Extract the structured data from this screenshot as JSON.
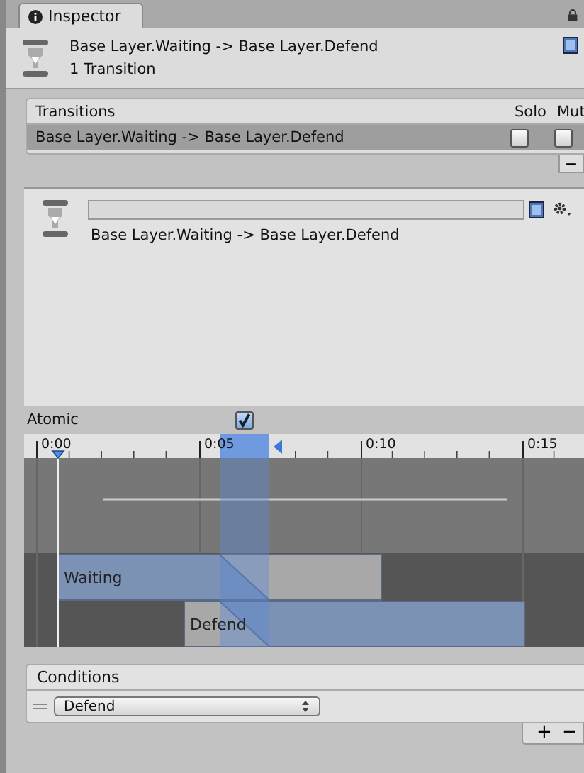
{
  "tab": {
    "title": "Inspector",
    "selected": true
  },
  "header": {
    "title": "Base Layer.Waiting -> Base Layer.Defend",
    "subtitle": "1 Transition"
  },
  "transitions": {
    "title": "Transitions",
    "columns": [
      "Solo",
      "Mut"
    ],
    "rows": [
      {
        "name": "Base Layer.Waiting -> Base Layer.Defend",
        "selected": true,
        "solo": false,
        "mute": false
      }
    ],
    "footer_buttons": [
      "−"
    ]
  },
  "transition": {
    "name": "Base Layer.Waiting -> Base Layer.Defend"
  },
  "atomic": {
    "label": "Atomic",
    "checked": true
  },
  "timeline": {
    "ticks": [
      "0:00",
      "0:05",
      "0:10",
      "0:15"
    ],
    "states": [
      {
        "name": "Waiting"
      },
      {
        "name": "Defend"
      }
    ]
  },
  "conditions": {
    "title": "Conditions",
    "items": [
      {
        "parameter": "Defend"
      }
    ],
    "footer_buttons": [
      "+",
      "−"
    ]
  }
}
